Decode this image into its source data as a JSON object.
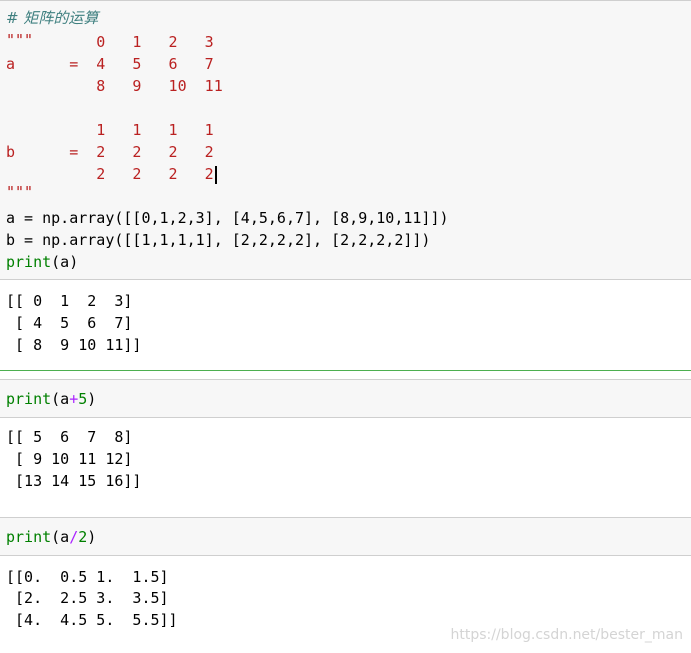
{
  "cell1": {
    "comment": "# 矩阵的运算",
    "doc_open": "\"\"\"",
    "doc_line1": "          0   1   2   3",
    "doc_line2": "a      =  4   5   6   7",
    "doc_line3": "          8   9   10  11",
    "doc_line4": "",
    "doc_line5": "          1   1   1   1",
    "doc_line6": "b      =  2   2   2   2",
    "doc_line7": "          2   2   2   2",
    "doc_close": "\"\"\"",
    "code_a": "a = np.array([[0,1,2,3], [4,5,6,7], [8,9,10,11]])",
    "code_b": "b = np.array([[1,1,1,1], [2,2,2,2], [2,2,2,2]])",
    "code_print_fn": "print",
    "code_print_args": "(a)",
    "output": [
      "[[ 0  1  2  3]",
      " [ 4  5  6  7]",
      " [ 8  9 10 11]]"
    ]
  },
  "cell2": {
    "print_fn": "print",
    "arg_open": "(a",
    "operator": "+",
    "number": "5",
    "arg_close": ")",
    "output": [
      "[[ 5  6  7  8]",
      " [ 9 10 11 12]",
      " [13 14 15 16]]"
    ]
  },
  "cell3": {
    "print_fn": "print",
    "arg_open": "(a",
    "operator": "/",
    "number": "2",
    "arg_close": ")",
    "output": [
      "[[0.  0.5 1.  1.5]",
      " [2.  2.5 3.  3.5]",
      " [4.  4.5 5.  5.5]]"
    ]
  },
  "watermark": "https://blog.csdn.net/bester_man"
}
